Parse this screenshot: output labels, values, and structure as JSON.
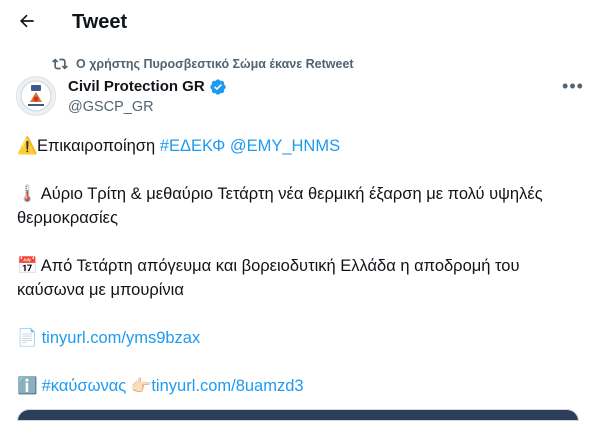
{
  "header": {
    "title": "Tweet",
    "back_icon": "arrow-left-icon"
  },
  "retweet": {
    "icon": "retweet-icon",
    "text": "Ο χρήστης Πυροσβεστικό Σώμα έκανε Retweet"
  },
  "author": {
    "display_name": "Civil Protection GR",
    "handle": "@GSCP_GR",
    "verified_icon": "verified-badge-icon",
    "verified_color": "#1d9bf0"
  },
  "more_label": "•••",
  "tweet": {
    "line1": {
      "emoji": "⚠️",
      "text": "Επικαιροποίηση ",
      "hashtag": "#ΕΔΕΚΦ",
      "mention": "@ΕΜΥ_HNMS"
    },
    "line2": {
      "emoji": "🌡️",
      "text": "Αύριο Τρίτη & μεθαύριο Τετάρτη νέα θερμική έξαρση με πολύ υψηλές θερμοκρασίες"
    },
    "line3": {
      "emoji": "📅",
      "text": "Από Τετάρτη απόγευμα και βορειοδυτική Ελλάδα η αποδρομή του καύσωνα με μπουρίνια"
    },
    "line4": {
      "emoji": "📄",
      "link": "tinyurl.com/yms9bzax"
    },
    "line5": {
      "emoji": "ℹ️",
      "hashtag": "#καύσωνας",
      "pointer": "👉🏻",
      "link": "tinyurl.com/8uamzd3"
    }
  },
  "colors": {
    "link": "#1d9bf0",
    "secondary_text": "#536471",
    "primary_text": "#0f1419"
  }
}
